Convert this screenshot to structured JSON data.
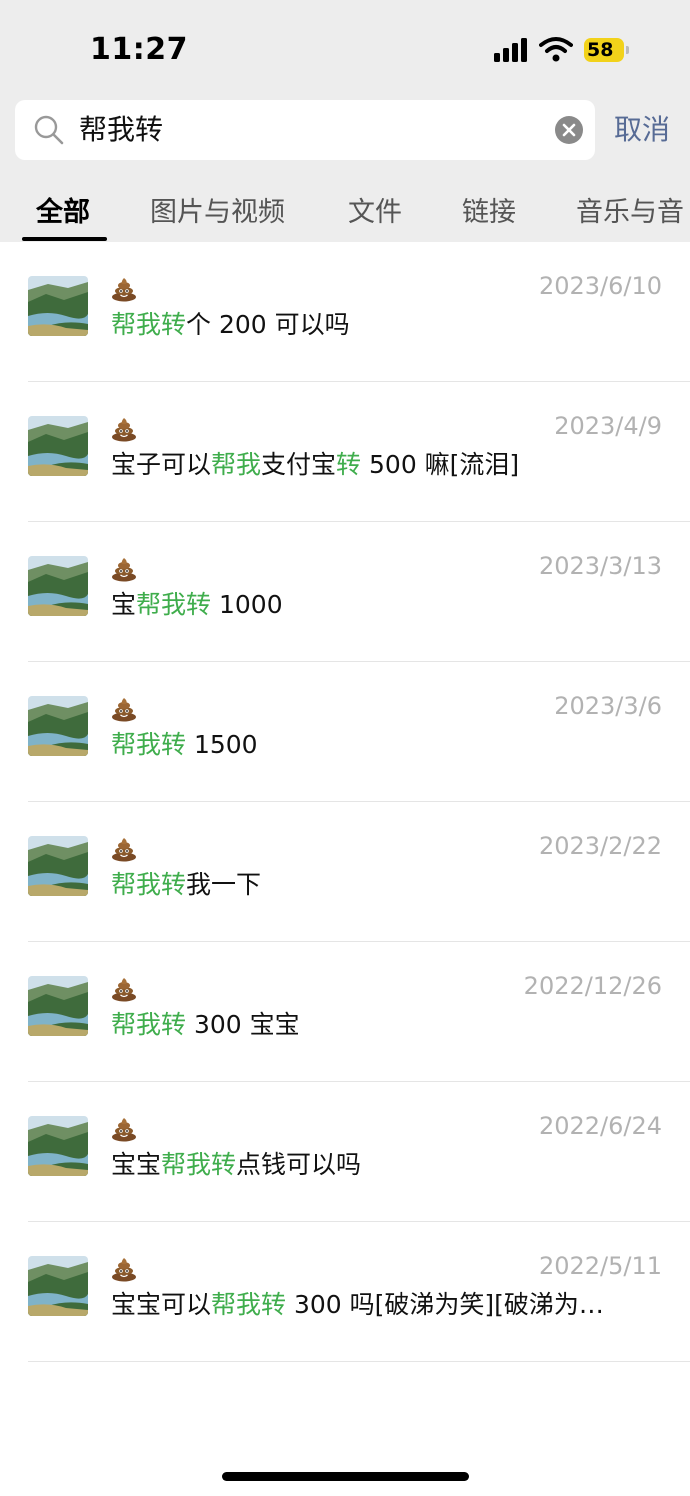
{
  "status_bar": {
    "time": "11:27",
    "battery": "58"
  },
  "search": {
    "query": "帮我转",
    "cancel_label": "取消"
  },
  "tabs": [
    "全部",
    "图片与视频",
    "文件",
    "链接",
    "音乐与音"
  ],
  "colors": {
    "highlight": "#3fad4c",
    "link": "#576b95",
    "date": "#b2b2b2"
  },
  "sender_icon": "pile-of-poo-emoji",
  "results": [
    {
      "date": "2023/6/10",
      "segments": [
        {
          "text": "帮我转",
          "hl": true
        },
        {
          "text": "个 200 可以吗",
          "hl": false
        }
      ]
    },
    {
      "date": "2023/4/9",
      "segments": [
        {
          "text": "宝子可以",
          "hl": false
        },
        {
          "text": "帮我",
          "hl": true
        },
        {
          "text": "支付宝",
          "hl": false
        },
        {
          "text": "转",
          "hl": true
        },
        {
          "text": " 500 嘛[流泪]",
          "hl": false
        }
      ]
    },
    {
      "date": "2023/3/13",
      "segments": [
        {
          "text": "宝",
          "hl": false
        },
        {
          "text": "帮我转",
          "hl": true
        },
        {
          "text": " 1000",
          "hl": false
        }
      ]
    },
    {
      "date": "2023/3/6",
      "segments": [
        {
          "text": "帮我转",
          "hl": true
        },
        {
          "text": " 1500",
          "hl": false
        }
      ]
    },
    {
      "date": "2023/2/22",
      "segments": [
        {
          "text": "帮我转",
          "hl": true
        },
        {
          "text": "我一下",
          "hl": false
        }
      ]
    },
    {
      "date": "2022/12/26",
      "segments": [
        {
          "text": "帮我转",
          "hl": true
        },
        {
          "text": " 300 宝宝",
          "hl": false
        }
      ]
    },
    {
      "date": "2022/6/24",
      "segments": [
        {
          "text": "宝宝",
          "hl": false
        },
        {
          "text": "帮我转",
          "hl": true
        },
        {
          "text": "点钱可以吗",
          "hl": false
        }
      ]
    },
    {
      "date": "2022/5/11",
      "segments": [
        {
          "text": "宝宝可以",
          "hl": false
        },
        {
          "text": "帮我转",
          "hl": true
        },
        {
          "text": " 300 吗[破涕为笑][破涕为…",
          "hl": false
        }
      ]
    }
  ]
}
